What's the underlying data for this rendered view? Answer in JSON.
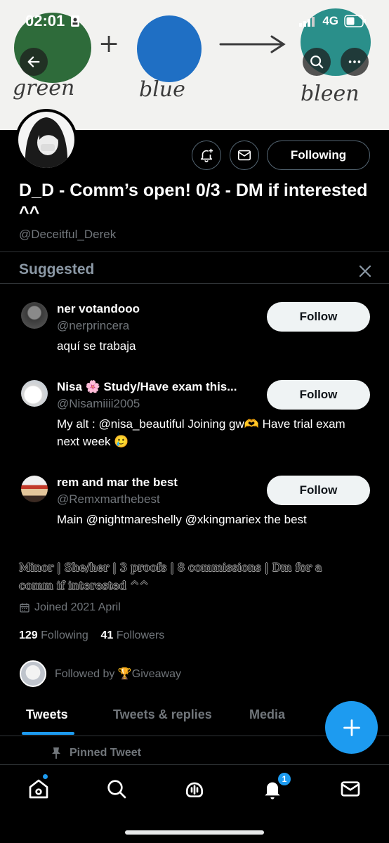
{
  "status_bar": {
    "time": "02:01",
    "network": "4G"
  },
  "banner": {
    "words": [
      "green",
      "+",
      "blue",
      "bleen"
    ],
    "colors": {
      "green": "#2e6b3a",
      "blue": "#1f6fc4",
      "bleen": "#2a8f8a"
    }
  },
  "profile": {
    "display_name": "D_D - Comm’s open! 0/3 - DM if interested ^^",
    "handle": "@Deceitful_Derek",
    "following_button": "Following",
    "bio": "Minor | She/her | 3 proofs | 8 commissions | Dm for a comm if interested ^^",
    "joined": "Joined 2021 April",
    "following_count": "129",
    "following_label": "Following",
    "followers_count": "41",
    "followers_label": "Followers",
    "followed_by": "Followed by 🏆Giveaway"
  },
  "suggested": {
    "title": "Suggested",
    "follow_label": "Follow",
    "items": [
      {
        "name": "ner votandooo",
        "handle": "@nerprincera",
        "bio": "aquí se trabaja"
      },
      {
        "name": "Nisa 🌸 Study/Have exam this...",
        "handle": "@Nisamiiii2005",
        "bio": "My alt : @nisa_beautiful Joining gw🫶 Have trial exam next week 🥲"
      },
      {
        "name": "rem and mar the best",
        "handle": "@Remxmarthebest",
        "bio": "Main @nightmareshelly @xkingmariex the best"
      }
    ]
  },
  "tabs": [
    "Tweets",
    "Tweets & replies",
    "Media"
  ],
  "pinned_label": "Pinned Tweet",
  "nav": {
    "notification_badge": "1"
  },
  "theme": {
    "accent": "#1d9bf0",
    "background": "#000000",
    "muted": "#71767b"
  }
}
